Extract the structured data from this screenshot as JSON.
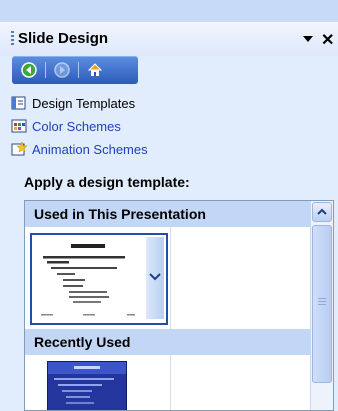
{
  "panel": {
    "title": "Slide Design"
  },
  "tasks": [
    {
      "label": "Design Templates",
      "icon": "design-templates-icon"
    },
    {
      "label": "Color Schemes",
      "icon": "color-schemes-icon"
    },
    {
      "label": "Animation Schemes",
      "icon": "animation-schemes-icon"
    }
  ],
  "section": {
    "heading": "Apply a design template:"
  },
  "groups": {
    "used": "Used in This Presentation",
    "recent": "Recently Used"
  },
  "colors": {
    "pane_bg": "#e1ecfc",
    "nav_blue": "#2c5bb9",
    "link_blue": "#1f3fbf",
    "group_header": "#c2d6f5"
  }
}
